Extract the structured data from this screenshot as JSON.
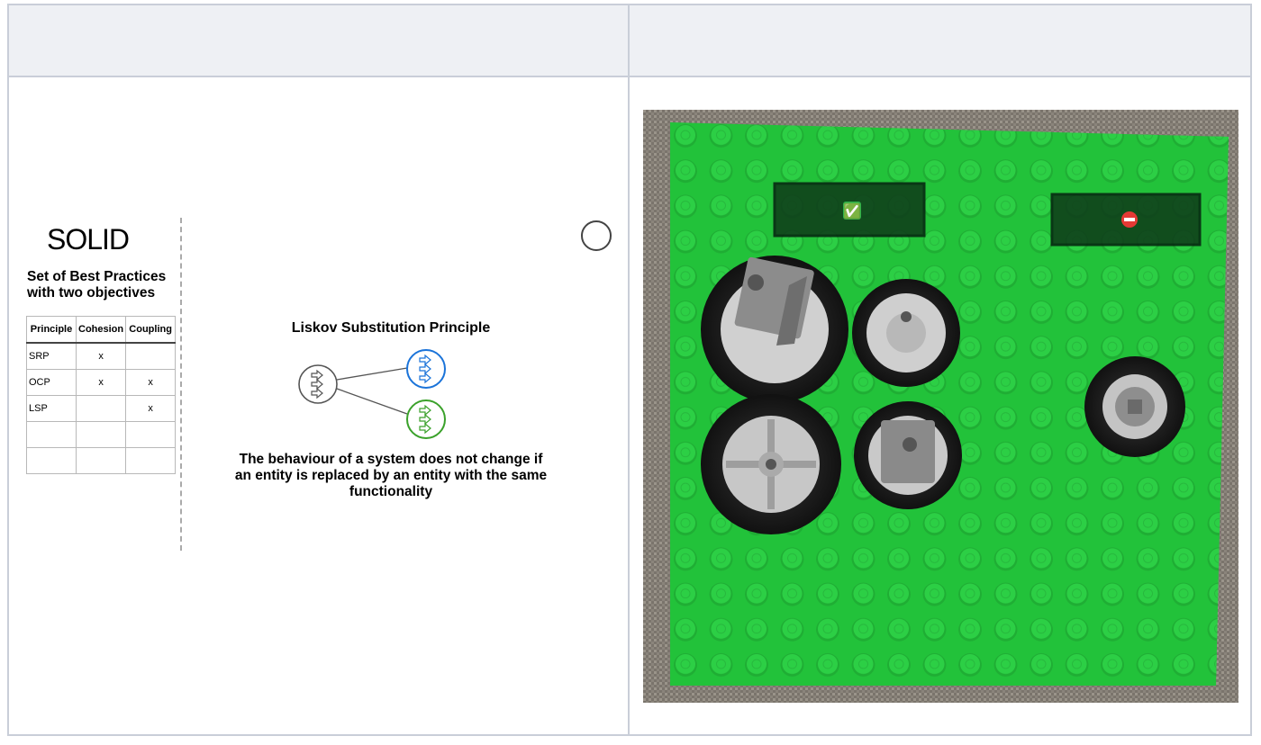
{
  "left_panel": {
    "solid_title": "SOLID",
    "solid_subtitle": "Set of Best Practices with two objectives",
    "table": {
      "headers": [
        "Principle",
        "Cohesion",
        "Coupling"
      ],
      "rows": [
        [
          "SRP",
          "x",
          ""
        ],
        [
          "OCP",
          "x",
          "x"
        ],
        [
          "LSP",
          "",
          "x"
        ],
        [
          "",
          "",
          ""
        ],
        [
          "",
          "",
          ""
        ]
      ]
    },
    "lsp": {
      "title": "Liskov Substitution Principle",
      "description": "The behaviour of a system does not change if an entity is replaced by an entity with the same functionality",
      "node_colors": [
        "#555555",
        "#1a73d9",
        "#3aa12a"
      ]
    }
  },
  "right_panel": {
    "photo": {
      "subject": "lego-baseplate-with-wheels",
      "good_marker": "✅",
      "bad_marker": "⛔",
      "baseplate_color": "#22c23a"
    }
  }
}
